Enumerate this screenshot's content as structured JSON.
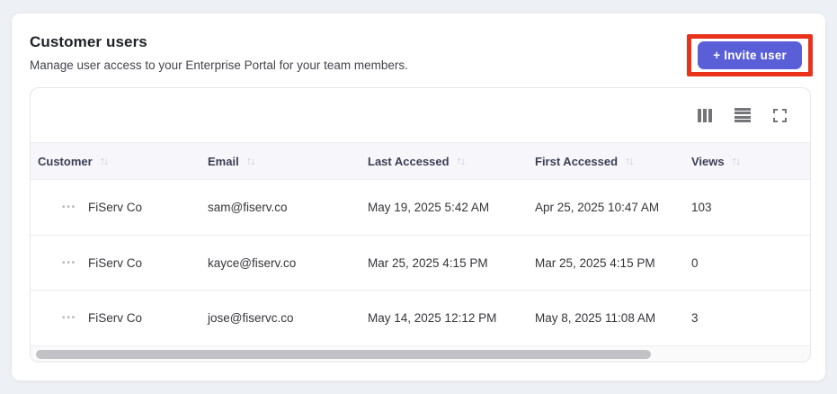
{
  "panel": {
    "title": "Customer users",
    "subtitle": "Manage user access to your Enterprise Portal for your team members.",
    "invite_button_label": "+ Invite user"
  },
  "colors": {
    "accent": "#5a5fd8",
    "annotation_highlight": "#e8321c",
    "page_background": "#edf0f4",
    "header_row_background": "#f7f7fb"
  },
  "icons": {
    "sort": "↑↓",
    "row_menu": "•••",
    "toolbar": [
      "columns-icon",
      "row-density-icon",
      "fullscreen-icon"
    ]
  },
  "table": {
    "columns": [
      {
        "label": "Customer",
        "sortable": true
      },
      {
        "label": "Email",
        "sortable": true
      },
      {
        "label": "Last Accessed",
        "sortable": true
      },
      {
        "label": "First Accessed",
        "sortable": true
      },
      {
        "label": "Views",
        "sortable": true
      }
    ],
    "rows": [
      {
        "customer": "FiServ Co",
        "email": "sam@fiserv.co",
        "last_accessed": "May 19, 2025 5:42 AM",
        "first_accessed": "Apr 25, 2025 10:47 AM",
        "views": "103"
      },
      {
        "customer": "FiServ Co",
        "email": "kayce@fiserv.co",
        "last_accessed": "Mar 25, 2025 4:15 PM",
        "first_accessed": "Mar 25, 2025 4:15 PM",
        "views": "0"
      },
      {
        "customer": "FiServ Co",
        "email": "jose@fiservc.co",
        "last_accessed": "May 14, 2025 12:12 PM",
        "first_accessed": "May 8, 2025 11:08 AM",
        "views": "3"
      }
    ]
  }
}
